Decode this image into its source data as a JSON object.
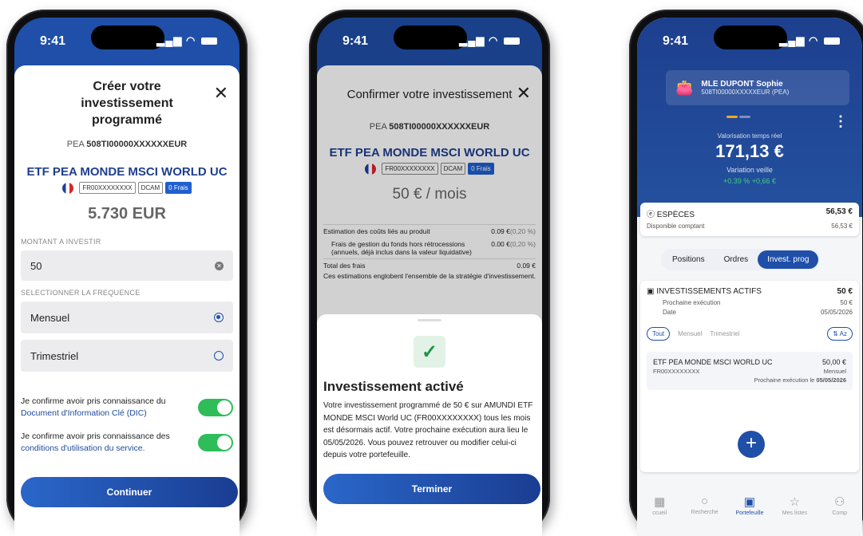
{
  "status": {
    "time": "9:41"
  },
  "screen1": {
    "title": "Créer votre investissement programmé",
    "account_prefix": "PEA",
    "account_number": "508TI00000XXXXXXEUR",
    "fund_name": "ETF PEA MONDE MSCI WORLD UC",
    "isin": "FR00XXXXXXXX",
    "tag_dcam": "DCAM",
    "tag_frais": "0 Frais",
    "balance": "5.730 EUR",
    "amount_label": "MONTANT A INVESTIR",
    "amount_value": "50",
    "frequency_label": "SELECTIONNER LA FREQUENCE",
    "freq_monthly": "Mensuel",
    "freq_quarterly": "Trimestriel",
    "confirm1_text": "Je confirme avoir pris connaissance du",
    "confirm1_link": "Document d'Information Clé (DIC)",
    "confirm2_text": "Je confirme avoir pris connaissance des",
    "confirm2_link": "conditions d'utilisation du service.",
    "cta": "Continuer"
  },
  "screen2": {
    "title": "Confirmer votre investissement",
    "account_prefix": "PEA",
    "account_number": "508TI00000XXXXXXEUR",
    "fund_name": "ETF PEA MONDE MSCI WORLD UC",
    "isin": "FR00XXXXXXXX",
    "tag_dcam": "DCAM",
    "tag_frais": "0 Frais",
    "amount": "50 € / mois",
    "cost1_label": "Estimation des coûts liés au produit",
    "cost1_value": "0.09 €",
    "cost1_pct": "(0,20 %)",
    "cost2_label": "Frais de gestion du fonds hors rétrocessions (annuels, déjà inclus dans la valeur liquidative)",
    "cost2_value": "0.00 €",
    "cost2_pct": "(0,20 %)",
    "total_label": "Total des frais",
    "total_value": "0.09 €",
    "total_note": "Ces estimations englobent l'ensemble de la stratégie d'investissement.",
    "success_title": "Investissement activé",
    "success_text": "Votre investissement programmé de 50 € sur AMUNDI ETF MONDE MSCI World UC (FR00XXXXXXXX) tous les mois est désormais actif. Votre prochaine exécution aura lieu le 05/05/2026. Vous pouvez retrouver ou modifier celui-ci depuis votre portefeuille.",
    "cta": "Terminer"
  },
  "screen3": {
    "holder": "MLE DUPONT Sophie",
    "account": "508TI00000XXXXXEUR (PEA)",
    "valuation_label": "Valorisation temps réel",
    "valuation": "171,13 €",
    "variation_label": "Variation veille",
    "variation": "+0.39 %  +0,66 €",
    "cash_label": "ESPÈCES",
    "cash_value": "56,53 €",
    "cash_sub": "Disponible comptant",
    "cash_sub_value": "56,53 €",
    "tab_positions": "Positions",
    "tab_orders": "Ordres",
    "tab_invest": "Invest. prog",
    "active_label": "INVESTISSEMENTS ACTIFS",
    "active_value": "50 €",
    "next_label": "Prochaine exécution",
    "next_value": "50 €",
    "date_label": "Date",
    "date_value": "05/05/2026",
    "filter_all": "Tout",
    "filter_monthly": "Mensuel",
    "filter_quarterly": "Trimestriel",
    "sort": "Az",
    "item_name": "ETF PEA MONDE MSCI WORLD UC",
    "item_amount": "50,00 €",
    "item_isin": "FR00XXXXXXXX",
    "item_freq": "Mensuel",
    "item_next_label": "Prochaine exécution le",
    "item_next_date": "05/05/2026",
    "nav": [
      "ccueil",
      "Recherche",
      "Portefeuille",
      "Mes listes",
      "Comp"
    ]
  }
}
